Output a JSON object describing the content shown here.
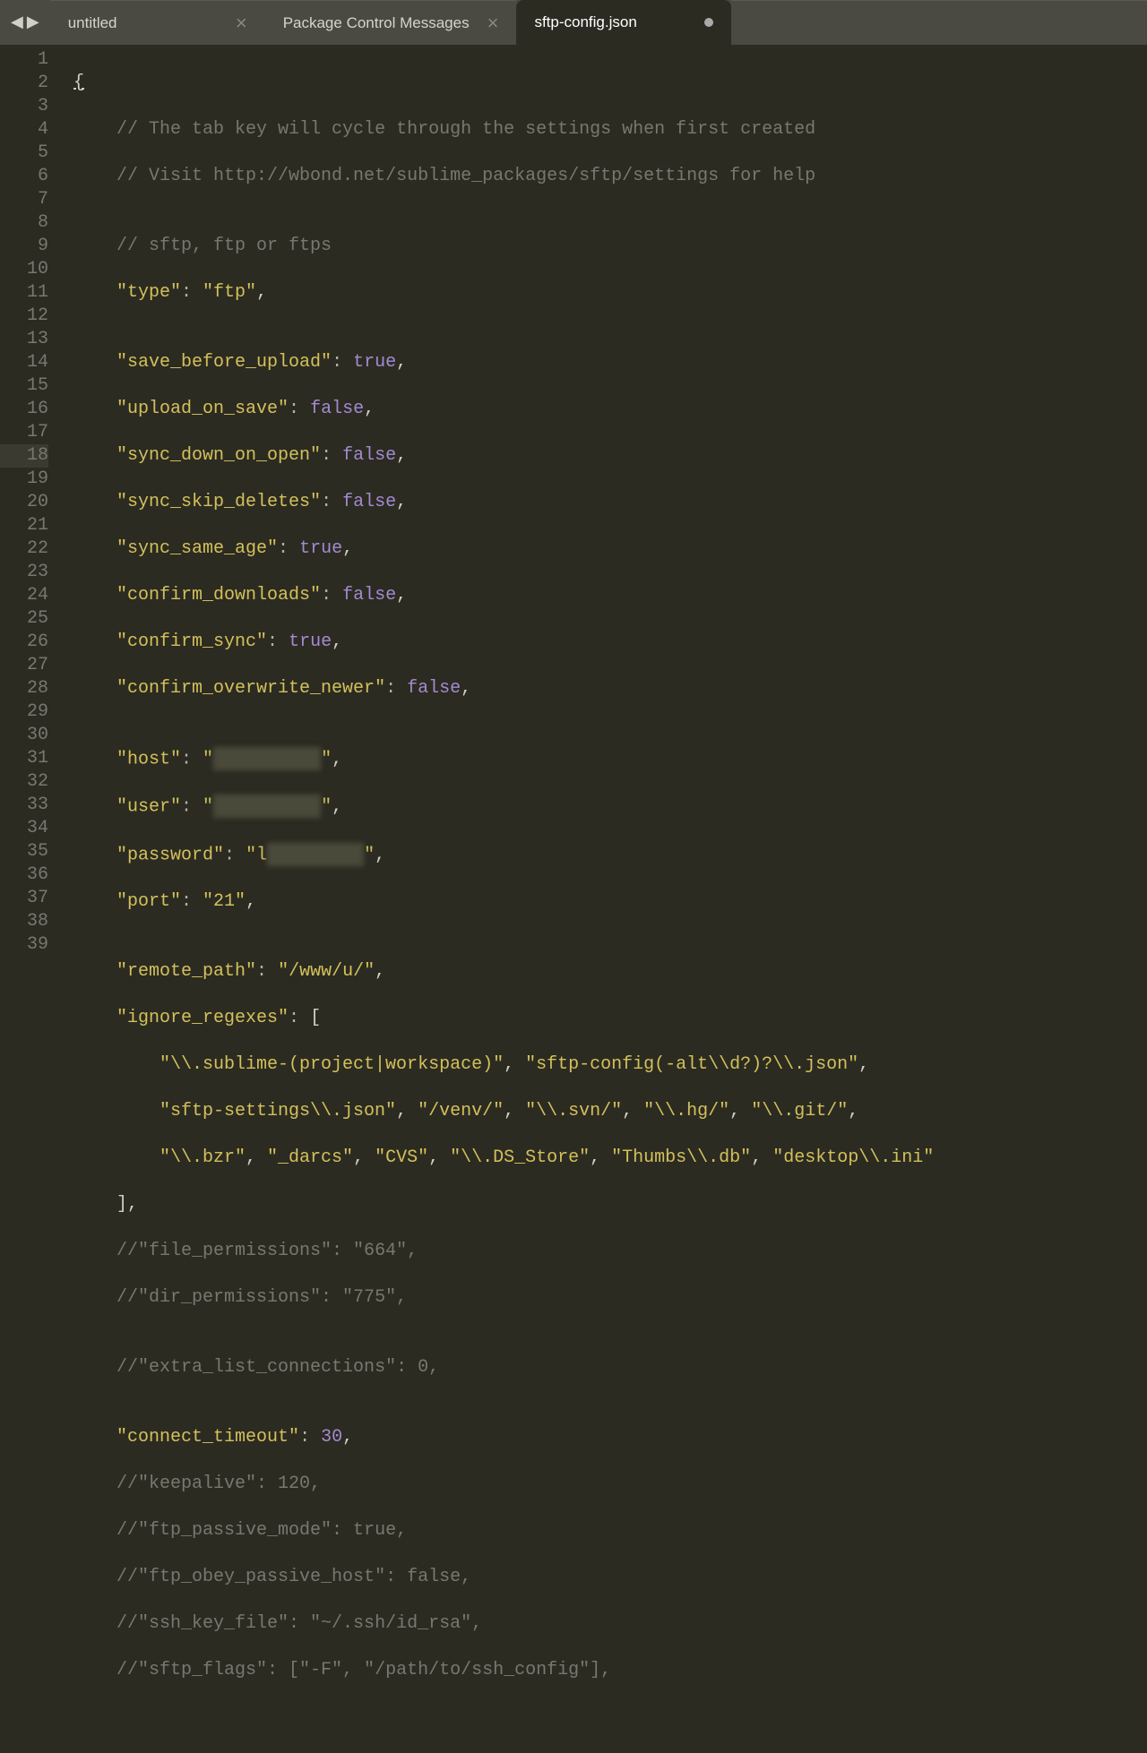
{
  "tabs": [
    {
      "label": "untitled",
      "active": false,
      "dirty": false
    },
    {
      "label": "Package Control Messages",
      "active": false,
      "dirty": false
    },
    {
      "label": "sftp-config.json",
      "active": true,
      "dirty": true
    }
  ],
  "gutter": {
    "start": 1,
    "end": 39,
    "modified": [
      6,
      17,
      18,
      19,
      20,
      22
    ],
    "highlighted": 18
  },
  "code": {
    "l1": "{",
    "l2_c": "// The tab key will cycle through the settings when first created",
    "l3_c": "// Visit http://wbond.net/sublime_packages/sftp/settings for help",
    "l5_c": "// sftp, ftp or ftps",
    "l6_k": "\"type\"",
    "l6_v": "\"ftp\"",
    "l8_k": "\"save_before_upload\"",
    "l8_v": "true",
    "l9_k": "\"upload_on_save\"",
    "l9_v": "false",
    "l10_k": "\"sync_down_on_open\"",
    "l10_v": "false",
    "l11_k": "\"sync_skip_deletes\"",
    "l11_v": "false",
    "l12_k": "\"sync_same_age\"",
    "l12_v": "true",
    "l13_k": "\"confirm_downloads\"",
    "l13_v": "false",
    "l14_k": "\"confirm_sync\"",
    "l14_v": "true",
    "l15_k": "\"confirm_overwrite_newer\"",
    "l15_v": "false",
    "l17_k": "\"host\"",
    "l17_q": "\"",
    "l17_q2": "\"",
    "l18_k": "\"user\"",
    "l18_q": "\"",
    "l18_q2": "\"",
    "l19_k": "\"password\"",
    "l19_q": "\"l",
    "l19_q2": "\"",
    "l20_k": "\"port\"",
    "l20_v": "\"21\"",
    "l22_k": "\"remote_path\"",
    "l22_v": "\"/www/u/\"",
    "l23_k": "\"ignore_regexes\"",
    "l23_b": "[",
    "l24_a": "\"\\\\.sublime-(project|workspace)\"",
    "l24_b": "\"sftp-config(-alt\\\\d?)?\\\\.json\"",
    "l25_a": "\"sftp-settings\\\\.json\"",
    "l25_b": "\"/venv/\"",
    "l25_c": "\"\\\\.svn/\"",
    "l25_d": "\"\\\\.hg/\"",
    "l25_e": "\"\\\\.git/\"",
    "l26_a": "\"\\\\.bzr\"",
    "l26_b": "\"_darcs\"",
    "l26_c": "\"CVS\"",
    "l26_d": "\"\\\\.DS_Store\"",
    "l26_e": "\"Thumbs\\\\.db\"",
    "l26_f": "\"desktop\\\\.ini\"",
    "l27_b": "],",
    "l28_c": "//\"file_permissions\": \"664\",",
    "l29_c": "//\"dir_permissions\": \"775\",",
    "l31_c": "//\"extra_list_connections\": 0,",
    "l33_k": "\"connect_timeout\"",
    "l33_v": "30",
    "l34_c": "//\"keepalive\": 120,",
    "l35_c": "//\"ftp_passive_mode\": true,",
    "l36_c": "//\"ftp_obey_passive_host\": false,",
    "l37_c": "//\"ssh_key_file\": \"~/.ssh/id_rsa\",",
    "l38_c": "//\"sftp_flags\": [\"-F\", \"/path/to/ssh_config\"],"
  }
}
